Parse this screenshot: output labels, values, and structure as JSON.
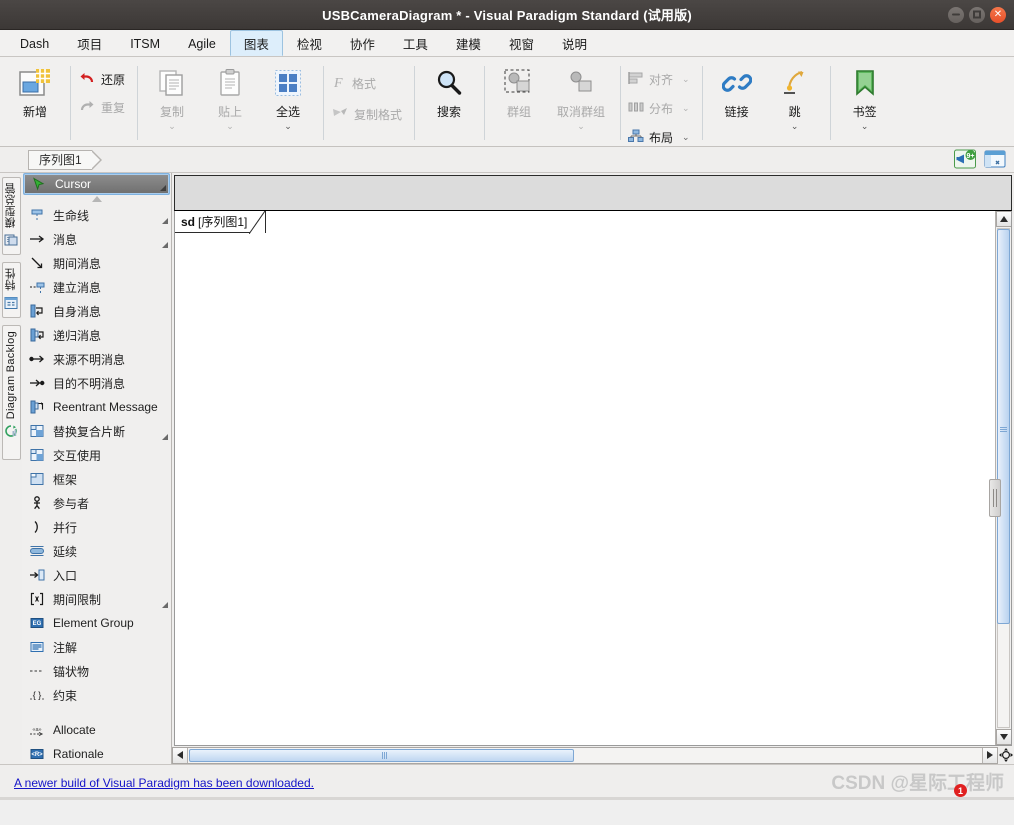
{
  "window": {
    "title": "USBCameraDiagram * - Visual Paradigm Standard (试用版)",
    "controls": {
      "minimize": "minimize-button",
      "maximize": "maximize-button",
      "close": "close-button"
    }
  },
  "menubar": {
    "items": [
      {
        "label": "Dash",
        "active": false
      },
      {
        "label": "项目",
        "active": false
      },
      {
        "label": "ITSM",
        "active": false
      },
      {
        "label": "Agile",
        "active": false
      },
      {
        "label": "图表",
        "active": true
      },
      {
        "label": "检视",
        "active": false
      },
      {
        "label": "协作",
        "active": false
      },
      {
        "label": "工具",
        "active": false
      },
      {
        "label": "建模",
        "active": false
      },
      {
        "label": "视窗",
        "active": false
      },
      {
        "label": "说明",
        "active": false
      }
    ]
  },
  "ribbon": {
    "new": {
      "label": "新增",
      "icon": "new-diagram-icon"
    },
    "undo": {
      "label": "还原",
      "icon": "undo-icon",
      "enabled": true
    },
    "redo": {
      "label": "重复",
      "icon": "redo-icon",
      "enabled": false
    },
    "copy": {
      "label": "复制",
      "icon": "copy-icon",
      "enabled": false,
      "caret": "⌄"
    },
    "paste": {
      "label": "贴上",
      "icon": "paste-icon",
      "enabled": false,
      "caret": "⌄"
    },
    "select_all": {
      "label": "全选",
      "icon": "select-all-icon",
      "enabled": true,
      "caret": "⌄"
    },
    "format": {
      "label": "格式",
      "icon": "format-F-icon",
      "enabled": false
    },
    "copy_format": {
      "label": "复制格式",
      "icon": "format-painter-icon",
      "enabled": false
    },
    "search": {
      "label": "搜索",
      "icon": "search-icon",
      "enabled": true
    },
    "group": {
      "label": "群组",
      "icon": "group-icon",
      "enabled": false
    },
    "ungroup": {
      "label": "取消群组",
      "icon": "ungroup-icon",
      "enabled": false,
      "caret": "⌄"
    },
    "align": {
      "label": "对齐",
      "icon": "align-icon",
      "enabled": false,
      "caret": "⌄"
    },
    "distribute": {
      "label": "分布",
      "icon": "distribute-icon",
      "enabled": false,
      "caret": "⌄"
    },
    "layout": {
      "label": "布局",
      "icon": "layout-icon",
      "enabled": true,
      "caret": "⌄"
    },
    "link": {
      "label": "链接",
      "icon": "link-icon",
      "enabled": true
    },
    "jump": {
      "label": "跳",
      "icon": "jump-icon",
      "enabled": true,
      "caret": "⌄"
    },
    "bookmark": {
      "label": "书签",
      "icon": "bookmark-icon",
      "enabled": true,
      "caret": "⌄"
    }
  },
  "breadcrumb": {
    "items": [
      "序列图1"
    ],
    "right_icons": [
      {
        "name": "announcement-icon",
        "badge": "9+"
      },
      {
        "name": "panel-layout-icon",
        "badge": ""
      }
    ]
  },
  "vertical_tabs": [
    {
      "label": "模型总管",
      "icon": "model-explorer-icon"
    },
    {
      "label": "特性",
      "icon": "properties-icon"
    },
    {
      "label": "Diagram Backlog",
      "icon": "backlog-icon"
    }
  ],
  "palette": {
    "items": [
      {
        "label": "Cursor",
        "icon": "cursor-arrow-icon",
        "selected": true,
        "expandable": true
      },
      {
        "label": "生命线",
        "icon": "lifeline-icon",
        "selected": false,
        "expandable": true
      },
      {
        "label": "消息",
        "icon": "message-arrow-icon",
        "selected": false,
        "expandable": true
      },
      {
        "label": "期间消息",
        "icon": "duration-message-icon",
        "selected": false,
        "expandable": false
      },
      {
        "label": "建立消息",
        "icon": "create-message-icon",
        "selected": false,
        "expandable": false
      },
      {
        "label": "自身消息",
        "icon": "self-message-icon",
        "selected": false,
        "expandable": false
      },
      {
        "label": "递归消息",
        "icon": "recursive-message-icon",
        "selected": false,
        "expandable": false
      },
      {
        "label": "来源不明消息",
        "icon": "found-message-icon",
        "selected": false,
        "expandable": false
      },
      {
        "label": "目的不明消息",
        "icon": "lost-message-icon",
        "selected": false,
        "expandable": false
      },
      {
        "label": "Reentrant Message",
        "icon": "reentrant-message-icon",
        "selected": false,
        "expandable": false
      },
      {
        "label": "替换复合片断",
        "icon": "alt-fragment-icon",
        "selected": false,
        "expandable": true
      },
      {
        "label": "交互使用",
        "icon": "interaction-use-icon",
        "selected": false,
        "expandable": false
      },
      {
        "label": "框架",
        "icon": "frame-icon",
        "selected": false,
        "expandable": false
      },
      {
        "label": "参与者",
        "icon": "actor-icon",
        "selected": false,
        "expandable": false
      },
      {
        "label": "并行",
        "icon": "parallel-icon",
        "selected": false,
        "expandable": false
      },
      {
        "label": "延续",
        "icon": "continuation-icon",
        "selected": false,
        "expandable": false
      },
      {
        "label": "入口",
        "icon": "gate-icon",
        "selected": false,
        "expandable": false
      },
      {
        "label": "期间限制",
        "icon": "duration-constraint-icon",
        "selected": false,
        "expandable": true
      },
      {
        "label": "Element Group",
        "icon": "element-group-icon",
        "selected": false,
        "expandable": false
      },
      {
        "label": "注解",
        "icon": "note-icon",
        "selected": false,
        "expandable": false
      },
      {
        "label": "锚状物",
        "icon": "anchor-icon",
        "selected": false,
        "expandable": false
      },
      {
        "label": "约束",
        "icon": "constraint-icon",
        "selected": false,
        "expandable": false
      }
    ],
    "items_after_separator": [
      {
        "label": "Allocate",
        "icon": "allocate-icon",
        "selected": false,
        "expandable": false
      },
      {
        "label": "Rationale",
        "icon": "rationale-icon",
        "selected": false,
        "expandable": false
      }
    ],
    "scroll_up": "▲",
    "scroll_down": "▼"
  },
  "canvas": {
    "frame_keyword": "sd",
    "frame_name": "[序列图1]"
  },
  "statusbar": {
    "message": "A newer build of Visual Paradigm has been downloaded.",
    "watermark": "CSDN @星际工程师",
    "notification_count": "1"
  }
}
